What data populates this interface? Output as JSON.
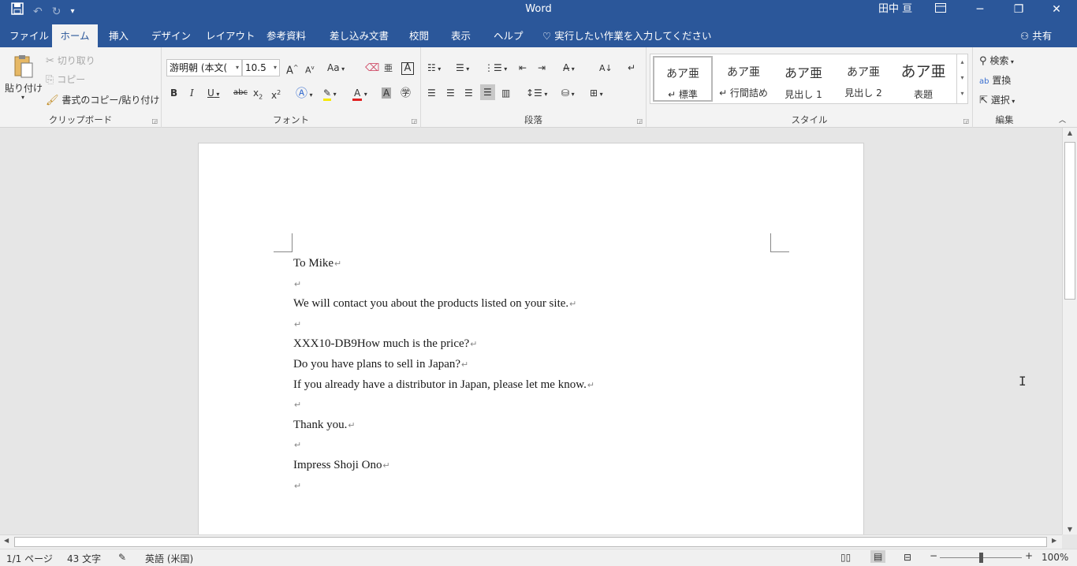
{
  "app": {
    "title": "Word",
    "user": "田中 亘"
  },
  "qat": {
    "save_icon": "save-icon",
    "undo_icon": "undo-icon",
    "redo_icon": "redo-icon",
    "customize_icon": "customize-qat-icon"
  },
  "tabs": [
    {
      "label": "ファイル"
    },
    {
      "label": "ホーム"
    },
    {
      "label": "挿入"
    },
    {
      "label": "デザイン"
    },
    {
      "label": "レイアウト"
    },
    {
      "label": "参考資料"
    },
    {
      "label": "差し込み文書"
    },
    {
      "label": "校閲"
    },
    {
      "label": "表示"
    },
    {
      "label": "ヘルプ"
    }
  ],
  "tell_me": "実行したい作業を入力してください",
  "share": "共有",
  "ribbon": {
    "clipboard": {
      "label": "クリップボード",
      "paste": "貼り付け",
      "cut": "切り取り",
      "copy": "コピー",
      "format_painter": "書式のコピー/貼り付け"
    },
    "font": {
      "label": "フォント",
      "font_name": "游明朝 (本文(",
      "font_size": "10.5",
      "case_label": "Aa"
    },
    "paragraph": {
      "label": "段落"
    },
    "styles": {
      "label": "スタイル",
      "items": [
        {
          "sample": "あア亜",
          "name": "↵ 標準"
        },
        {
          "sample": "あア亜",
          "name": "↵ 行間詰め"
        },
        {
          "sample": "あア亜",
          "name": "見出し 1"
        },
        {
          "sample": "あア亜",
          "name": "見出し 2"
        },
        {
          "sample": "あア亜",
          "name": "表題"
        }
      ]
    },
    "editing": {
      "label": "編集",
      "find": "検索",
      "replace": "置換",
      "select": "選択"
    }
  },
  "document": {
    "paragraphs": [
      "To Mike",
      "",
      "We will contact you about the products listed on your site.",
      "",
      "XXX10-DB9How much is the price?",
      "Do you have plans to sell in Japan?",
      "If you already have a distributor in Japan, please let me know.",
      "",
      "Thank you.",
      "",
      "Impress Shoji Ono",
      ""
    ],
    "paragraph_mark": "↵"
  },
  "status": {
    "page": "1/1 ページ",
    "words": "43 文字",
    "language": "英語 (米国)",
    "zoom": "100%",
    "zoom_level": 100
  }
}
